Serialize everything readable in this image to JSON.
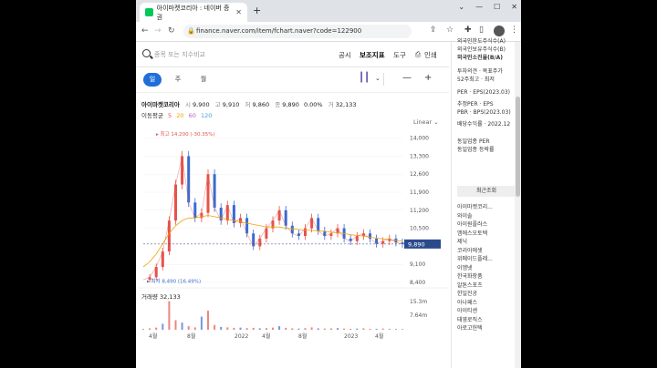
{
  "browser": {
    "tab_title": "아이마켓코리아 : 네이버 증권",
    "url": "finance.naver.com/item/fchart.naver?code=122900"
  },
  "toolbar": {
    "search_placeholder": "종목 또는 지수비교",
    "links": [
      "공시",
      "보조지표",
      "도구"
    ],
    "print_label": "인쇄"
  },
  "periods": [
    "일",
    "주",
    "월"
  ],
  "active_period": "일",
  "stock": {
    "name": "아이마켓코리아",
    "open_label": "시",
    "open": "9,900",
    "high_label": "고",
    "high": "9,910",
    "low_label": "저",
    "low": "9,860",
    "close_label": "종",
    "close": "9,890",
    "change": "0.00%",
    "volume_label": "거",
    "volume": "32,133"
  },
  "moving_average": {
    "label": "이동평균",
    "periods": [
      {
        "value": "5",
        "color": "#e5534b"
      },
      {
        "value": "20",
        "color": "#f0a400"
      },
      {
        "value": "60",
        "color": "#c05bbf"
      },
      {
        "value": "120",
        "color": "#3fa0e0"
      }
    ]
  },
  "scale_label": "Linear",
  "chart_data": {
    "type": "line",
    "price_ticks": [
      "14,000",
      "13,300",
      "12,600",
      "11,900",
      "11,200",
      "10,500",
      "9,890",
      "9,100",
      "8,400"
    ],
    "volume_ticks": [
      "15.3m",
      "7.64m"
    ],
    "x_labels": [
      "4월",
      "8월",
      "2022",
      "4월",
      "8월",
      "2023",
      "4월"
    ],
    "annotations": {
      "high_label": "최고",
      "high": "14,200 (-30.35%)",
      "low_label": "최저",
      "low": "8,490 (16.49%)",
      "current": "9,890"
    },
    "volume_label": "거래량",
    "volume_value": "32,133",
    "series_price": [
      8500,
      8600,
      9000,
      9600,
      10800,
      12200,
      13300,
      11500,
      10900,
      11100,
      12600,
      11300,
      10800,
      11400,
      10700,
      10900,
      10300,
      9800,
      10100,
      10500,
      10800,
      11200,
      10600,
      10300,
      10200,
      10500,
      10900,
      10400,
      10200,
      10300,
      10500,
      10100,
      10000,
      10200,
      10300,
      10100,
      9900,
      10000,
      10100,
      9950,
      9890
    ],
    "ma_120": [
      9000,
      9200,
      9500,
      9900,
      10300,
      10600,
      10800,
      10900,
      10900,
      10950,
      11000,
      10950,
      10900,
      10850,
      10800,
      10750,
      10700,
      10650,
      10600,
      10550,
      10550,
      10550,
      10500,
      10480,
      10450,
      10430,
      10420,
      10400,
      10380,
      10350,
      10320,
      10300,
      10250,
      10220,
      10200,
      10150,
      10120,
      10090,
      10060,
      10030,
      10000
    ],
    "volume_series": [
      0.3,
      0.6,
      0.9,
      2.5,
      12.0,
      4.0,
      3.0,
      1.5,
      1.0,
      5.5,
      8.0,
      2.0,
      1.2,
      1.0,
      0.8,
      0.9,
      0.7,
      0.8,
      0.6,
      0.7,
      0.9,
      1.5,
      0.8,
      0.6,
      0.5,
      0.7,
      1.0,
      0.6,
      0.5,
      0.6,
      0.7,
      0.5,
      0.4,
      0.5,
      0.6,
      0.4,
      0.4,
      0.5,
      0.4,
      0.3,
      0.3
    ],
    "ylim": [
      8400,
      14200
    ],
    "colors": {
      "up": "#e5534b",
      "down": "#3a6bd1",
      "ma": "#f0a400",
      "current": "#2b4a8b"
    }
  },
  "sidebar": {
    "rows_top": [
      "외국인한도주식수(A)",
      "외국인보유주식수(B)",
      "외국인소진율(B/A)"
    ],
    "rows_mid": [
      "투자의견 · 목표주가",
      "52주최고 · 최저"
    ],
    "rows_per": [
      "PER · EPS(2023.03)",
      "추정PER · EPS",
      "PBR · BPS(2023.03)",
      "배당수익률 · 2022.12"
    ],
    "industry": "동일업종 PER",
    "industry2": "동일업종 등락률",
    "recent_header": "최근조회",
    "recent": [
      "아이마켓코리...",
      "와이솔",
      "아이원플러스",
      "엠에스오토텍",
      "제닉",
      "코리아에셋",
      "위메이드플레...",
      "이엠넷",
      "한국화장품",
      "알톤스포츠",
      "한일진공",
      "아나패스",
      "아이티센",
      "태영로직스",
      "아로고헌텍"
    ]
  }
}
